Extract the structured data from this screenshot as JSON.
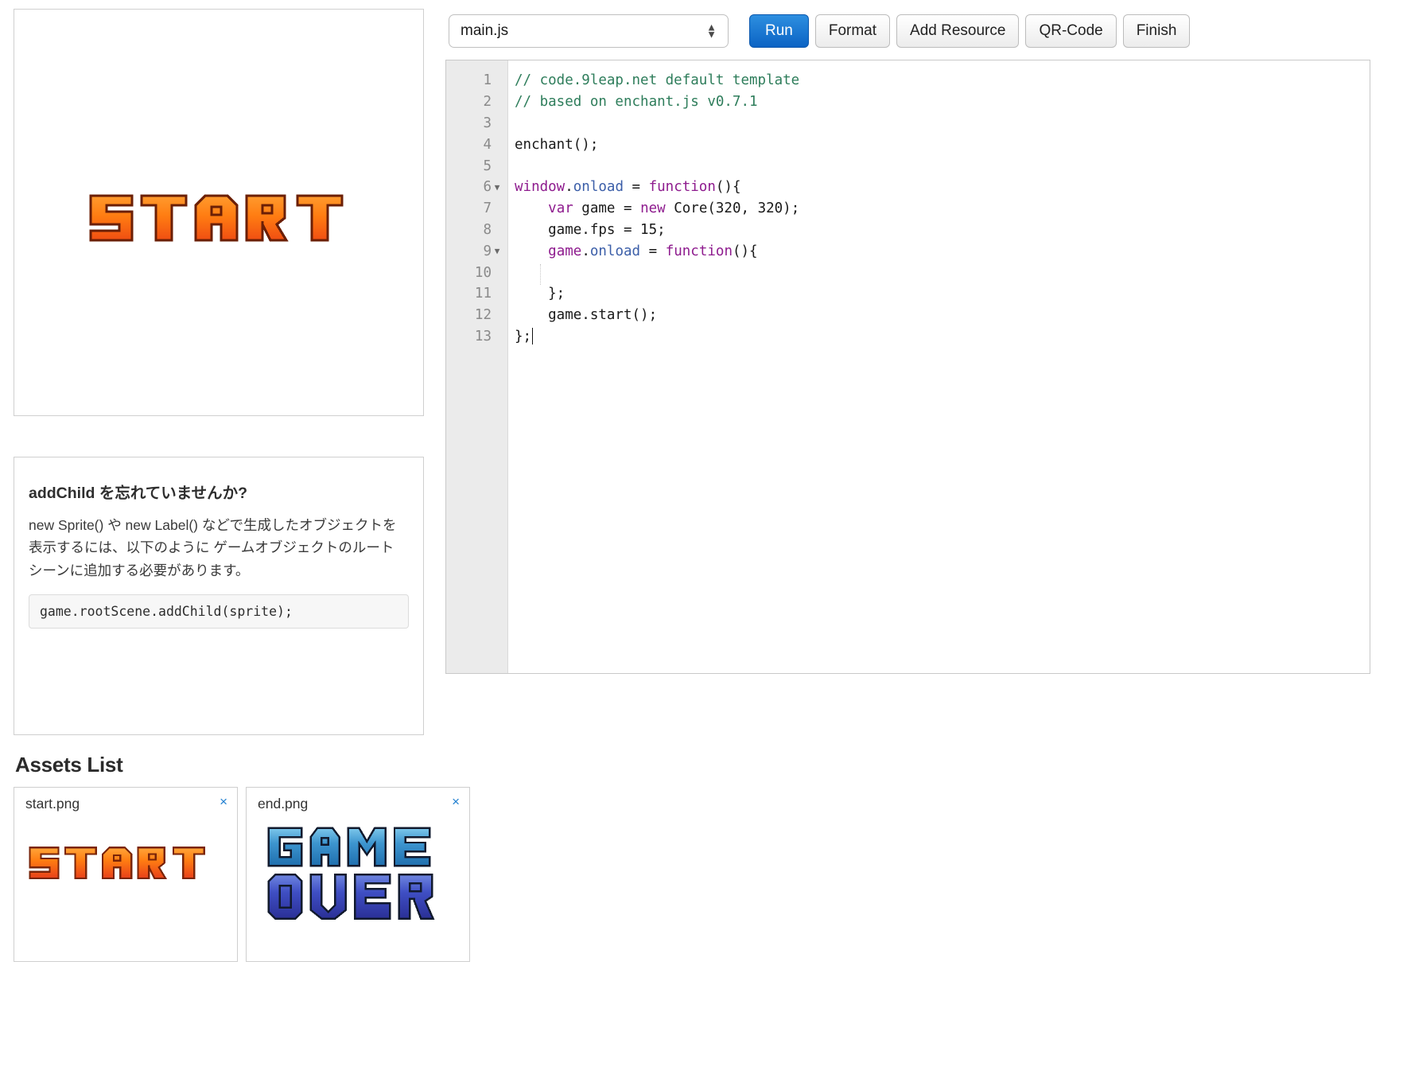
{
  "toolbar": {
    "file_select_value": "main.js",
    "file_select_options": [
      "main.js"
    ],
    "run_label": "Run",
    "format_label": "Format",
    "add_resource_label": "Add Resource",
    "qr_code_label": "QR-Code",
    "finish_label": "Finish",
    "run_color": "#0b63c4"
  },
  "editor": {
    "filename": "main.js",
    "line_numbers": [
      "1",
      "2",
      "3",
      "4",
      "5",
      "6",
      "7",
      "8",
      "9",
      "10",
      "11",
      "12",
      "13"
    ],
    "fold_lines": [
      6,
      9
    ],
    "lines": [
      {
        "n": 1,
        "text": "// code.9leap.net default template"
      },
      {
        "n": 2,
        "text": "// based on enchant.js v0.7.1"
      },
      {
        "n": 3,
        "text": ""
      },
      {
        "n": 4,
        "text": "enchant();"
      },
      {
        "n": 5,
        "text": ""
      },
      {
        "n": 6,
        "text": "window.onload = function(){"
      },
      {
        "n": 7,
        "text": "    var game = new Core(320, 320);"
      },
      {
        "n": 8,
        "text": "    game.fps = 15;"
      },
      {
        "n": 9,
        "text": "    game.onload = function(){"
      },
      {
        "n": 10,
        "text": ""
      },
      {
        "n": 11,
        "text": "    };"
      },
      {
        "n": 12,
        "text": "    game.start();"
      },
      {
        "n": 13,
        "text": "};"
      }
    ]
  },
  "preview": {
    "alt": "START",
    "image_text": "START"
  },
  "help": {
    "title": "addChild を忘れていませんか?",
    "body": "new Sprite() や new Label() などで生成したオブジェクトを表示するには、以下のように ゲームオブジェクトのルートシーンに追加する必要があります。",
    "code": "game.rootScene.addChild(sprite);"
  },
  "assets": {
    "heading": "Assets List",
    "close_glyph": "×",
    "items": [
      {
        "name": "start.png",
        "image_text": "START",
        "color": "#f47b20"
      },
      {
        "name": "end.png",
        "image_text": "GAME OVER",
        "color": "#3a8ec9"
      }
    ]
  }
}
